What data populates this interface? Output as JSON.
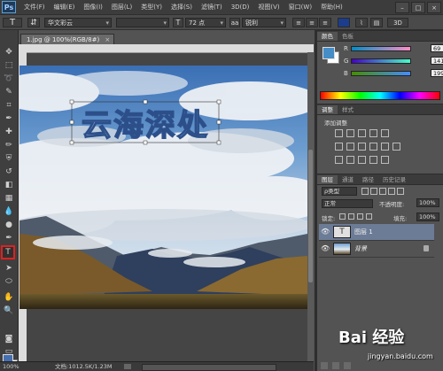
{
  "app": {
    "logo": "Ps"
  },
  "menu": [
    "文件(F)",
    "编辑(E)",
    "图像(I)",
    "图层(L)",
    "类型(Y)",
    "选择(S)",
    "滤镜(T)",
    "3D(D)",
    "视图(V)",
    "窗口(W)",
    "帮助(H)"
  ],
  "window_controls": [
    "–",
    "□",
    "×"
  ],
  "options": {
    "tool_glyph": "T",
    "font_family": "华文彩云",
    "font_size": "72 点",
    "antialias": "锐利"
  },
  "document": {
    "tab_title": "1.jpg @ 100%(RGB/8#)",
    "canvas_text": "云海深处"
  },
  "status": {
    "zoom": "100%",
    "doc_info": "文档:1012.5K/1.23M"
  },
  "color_panel": {
    "tabs": [
      "颜色",
      "色板"
    ],
    "channels": [
      {
        "label": "R",
        "value": "69"
      },
      {
        "label": "G",
        "value": "141"
      },
      {
        "label": "B",
        "value": "199"
      }
    ],
    "foreground": "#458dc7"
  },
  "adjustments_panel": {
    "tabs": [
      "调整",
      "样式"
    ],
    "add_label": "添加调整"
  },
  "layers_panel": {
    "tabs": [
      "图层",
      "通道",
      "路径",
      "历史记录"
    ],
    "kind_filter": "ρ类型",
    "blend_mode": "正常",
    "opacity_label": "不透明度:",
    "opacity_value": "100%",
    "lock_label": "锁定:",
    "fill_label": "填充:",
    "fill_value": "100%",
    "layers": [
      {
        "name": "图层 1",
        "type_glyph": "T",
        "selected": true
      },
      {
        "name": "背景",
        "type_glyph": "",
        "selected": false
      }
    ]
  },
  "watermark": {
    "brand": "Bai 经验",
    "url": "jingyan.baidu.com"
  }
}
